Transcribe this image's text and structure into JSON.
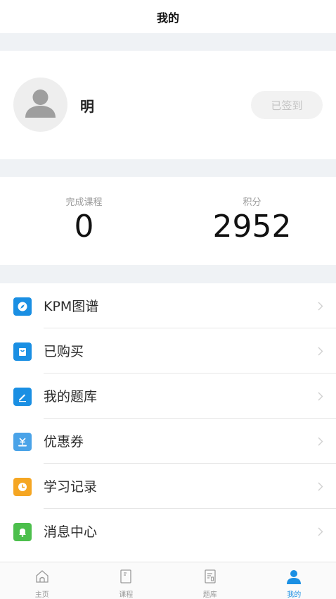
{
  "header": {
    "title": "我的"
  },
  "profile": {
    "username": "明",
    "checkin_label": "已签到"
  },
  "stats": [
    {
      "label": "完成课程",
      "value": "0"
    },
    {
      "label": "积分",
      "value": "2952"
    }
  ],
  "menu": [
    {
      "label": "KPM图谱",
      "icon": "compass-icon",
      "color": "#1a8fe3"
    },
    {
      "label": "已购买",
      "icon": "bag-icon",
      "color": "#1a8fe3"
    },
    {
      "label": "我的题库",
      "icon": "pencil-icon",
      "color": "#1a8fe3"
    },
    {
      "label": "优惠券",
      "icon": "coupon-icon",
      "color": "#4aa3e8"
    },
    {
      "label": "学习记录",
      "icon": "clock-icon",
      "color": "#f5a623"
    },
    {
      "label": "消息中心",
      "icon": "bell-icon",
      "color": "#4cbf4c"
    }
  ],
  "tabbar": [
    {
      "label": "主页",
      "icon": "home-icon",
      "active": false
    },
    {
      "label": "课程",
      "icon": "book-icon",
      "active": false
    },
    {
      "label": "题库",
      "icon": "quiz-icon",
      "active": false
    },
    {
      "label": "我的",
      "icon": "user-icon",
      "active": true
    }
  ],
  "colors": {
    "accent": "#1a8fe3",
    "background_gap": "#eff2f5"
  }
}
